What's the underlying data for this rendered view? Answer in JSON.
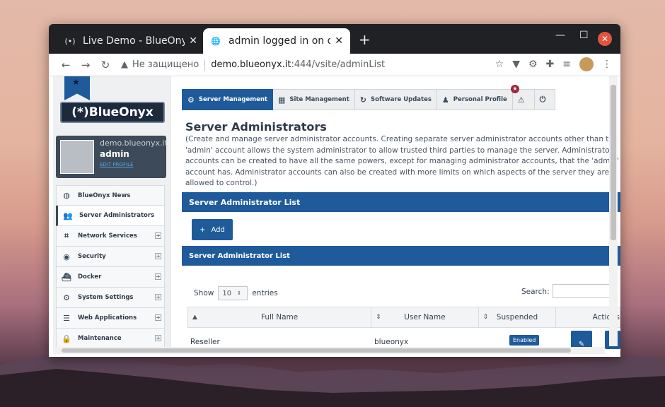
{
  "browser": {
    "tabs": [
      {
        "title": "Live Demo - BlueOnyx",
        "active": false
      },
      {
        "title": "admin logged in on dem",
        "active": true
      }
    ],
    "new_tab": "+",
    "address": {
      "security_label": "Не защищено",
      "host": "demo.blueonyx.it",
      "path": ":444/vsite/adminList"
    }
  },
  "sidebar": {
    "logo_text": "(*)BlueOnyx",
    "user": {
      "host": "demo.blueonyx.it",
      "name": "admin",
      "link": "EDIT PROFILE"
    },
    "items": [
      {
        "label": "BlueOnyx News",
        "icon": "globe-icon",
        "expandable": false,
        "active": false
      },
      {
        "label": "Server Administrators",
        "icon": "users-icon",
        "expandable": false,
        "active": true
      },
      {
        "label": "Network Services",
        "icon": "network-icon",
        "expandable": true,
        "active": false
      },
      {
        "label": "Security",
        "icon": "eye-icon",
        "expandable": true,
        "active": false
      },
      {
        "label": "Docker",
        "icon": "docker-icon",
        "expandable": true,
        "active": false
      },
      {
        "label": "System Settings",
        "icon": "gear-icon",
        "expandable": true,
        "active": false
      },
      {
        "label": "Web Applications",
        "icon": "server-icon",
        "expandable": true,
        "active": false
      },
      {
        "label": "Maintenance",
        "icon": "lock-icon",
        "expandable": true,
        "active": false
      }
    ]
  },
  "topnav": {
    "items": [
      {
        "label": "Server Management",
        "icon": "gear-icon",
        "active": true
      },
      {
        "label": "Site Management",
        "icon": "grid-icon",
        "active": false
      },
      {
        "label": "Software Updates",
        "icon": "refresh-icon",
        "active": false
      },
      {
        "label": "Personal Profile",
        "icon": "user-icon",
        "active": false
      },
      {
        "label": "",
        "icon": "warning-icon",
        "active": false
      },
      {
        "label": "",
        "icon": "logout-icon",
        "active": false
      }
    ],
    "badge": "★"
  },
  "page": {
    "title": "Server Administrators",
    "description": "(Create and manage server administrator accounts. Creating separate server administrator accounts other than the 'admin' account allows the system administrator to allow trusted third parties to manage the server. Administrator accounts can be created to have all the same powers, except for managing administrator accounts, that the 'admin' account has. Administrator accounts can also be created with more limits on which aspects of the server they are allowed to control.)",
    "panel_title": "Server Administrator List",
    "add_label": "Add",
    "sub_title": "Server Administrator List",
    "show_label": "Show",
    "entries_value": "10",
    "entries_label": "entries",
    "search_label": "Search:",
    "columns": [
      "Full Name",
      "User Name",
      "Suspended",
      "Actions"
    ],
    "rows": [
      {
        "full_name": "Reseller",
        "user_name": "blueonyx",
        "status": "Enabled"
      }
    ]
  },
  "colors": {
    "accent": "#1f5a9a",
    "badge": "#a3253a"
  }
}
